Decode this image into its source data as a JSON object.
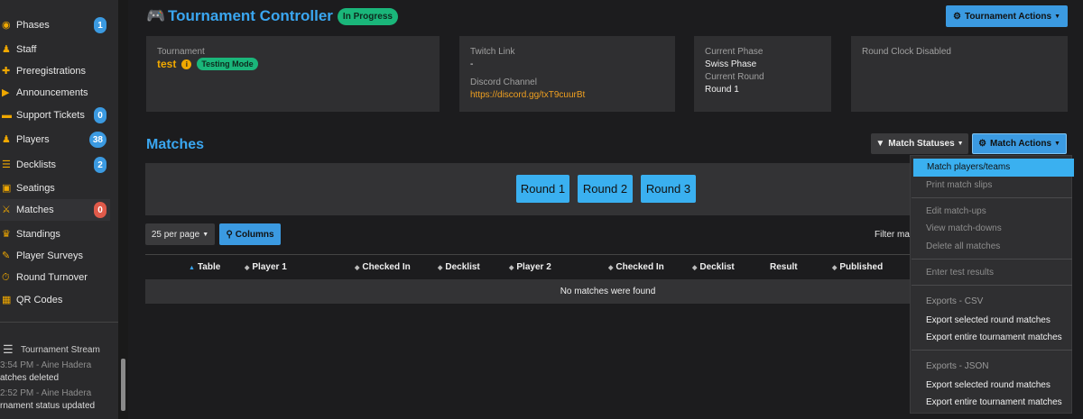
{
  "sidebar": {
    "items": [
      {
        "label": "Phases",
        "badge": "1",
        "icon": "sitemap-icon"
      },
      {
        "label": "Staff",
        "icon": "staff-icon"
      },
      {
        "label": "Preregistrations",
        "icon": "user-plus-icon"
      },
      {
        "label": "Announcements",
        "icon": "megaphone-icon"
      },
      {
        "label": "Support Tickets",
        "badge": "0",
        "icon": "ticket-icon"
      },
      {
        "label": "Players",
        "badge": "38",
        "icon": "users-icon"
      },
      {
        "label": "Decklists",
        "badge": "2",
        "icon": "list-icon"
      },
      {
        "label": "Seatings",
        "icon": "chair-icon"
      },
      {
        "label": "Matches",
        "badge": "0",
        "icon": "matches-icon"
      },
      {
        "label": "Standings",
        "icon": "trophy-icon"
      },
      {
        "label": "Player Surveys",
        "icon": "clipboard-icon"
      },
      {
        "label": "Round Turnover",
        "icon": "clock-icon"
      },
      {
        "label": "QR Codes",
        "icon": "qr-code-icon"
      }
    ],
    "stream_title": "Tournament Stream",
    "stream": [
      {
        "time": "3:54 PM - Aine Hadera",
        "msg": "atches deleted"
      },
      {
        "time": "2:52 PM - Aine Hadera",
        "msg": "rnament status updated"
      }
    ]
  },
  "header": {
    "title": "Tournament Controller",
    "status": "In Progress",
    "actions_label": "Tournament Actions"
  },
  "cards": {
    "tournament": {
      "label": "Tournament",
      "name": "test",
      "mode": "Testing Mode"
    },
    "links": {
      "twitch_label": "Twitch Link",
      "twitch_value": "-",
      "discord_label": "Discord Channel",
      "discord_value": "https://discord.gg/txT9cuurBt"
    },
    "phase": {
      "phase_label": "Current Phase",
      "phase_value": "Swiss Phase",
      "round_label": "Current Round",
      "round_value": "Round 1"
    },
    "clock": {
      "label": "Round Clock Disabled"
    }
  },
  "matches": {
    "title": "Matches",
    "statuses_label": "Match Statuses",
    "actions_label": "Match Actions",
    "rounds": [
      "Round 1",
      "Round 2",
      "Round 3"
    ],
    "per_page": "25 per page",
    "columns_label": "Columns",
    "filter_label": "Filter mat",
    "columns": [
      "Table",
      "Player 1",
      "Checked In",
      "Decklist",
      "Player 2",
      "Checked In",
      "Decklist",
      "Result",
      "Published"
    ],
    "empty": "No matches were found"
  },
  "dropdown": {
    "active": "Match players/teams",
    "print": "Print match slips",
    "edit": "Edit match-ups",
    "view": "View match-downs",
    "delete": "Delete all matches",
    "enter": "Enter test results",
    "csv_header": "Exports - CSV",
    "csv_round": "Export selected round matches",
    "csv_all": "Export entire tournament matches",
    "json_header": "Exports - JSON",
    "json_round": "Export selected round matches",
    "json_all": "Export entire tournament matches"
  }
}
